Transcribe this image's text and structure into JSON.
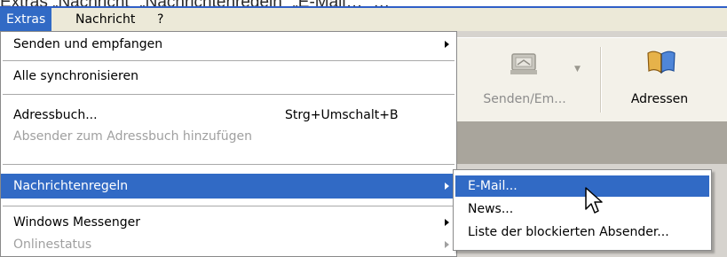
{
  "caption": {
    "text": "Extras „Nachricht“ „Nachrichtenregeln“ „E-Mail…“ …"
  },
  "menubar": {
    "items": [
      {
        "label": "Extras",
        "active": true
      },
      {
        "label": "Nachricht",
        "active": false
      },
      {
        "label": "?",
        "active": false
      }
    ]
  },
  "extras_menu": {
    "items": [
      {
        "label": "Senden und empfangen",
        "shortcut": "",
        "submenu": true,
        "disabled": false,
        "highlighted": false
      },
      {
        "label": "Alle synchronisieren",
        "shortcut": "",
        "submenu": false,
        "disabled": false,
        "highlighted": false
      },
      {
        "label": "Adressbuch...",
        "shortcut": "Strg+Umschalt+B",
        "submenu": false,
        "disabled": false,
        "highlighted": false
      },
      {
        "label": "Absender zum Adressbuch hinzufügen",
        "shortcut": "",
        "submenu": false,
        "disabled": true,
        "highlighted": false
      },
      {
        "label": "Nachrichtenregeln",
        "shortcut": "",
        "submenu": true,
        "disabled": false,
        "highlighted": true
      },
      {
        "label": "Windows Messenger",
        "shortcut": "",
        "submenu": true,
        "disabled": false,
        "highlighted": false
      },
      {
        "label": "Onlinestatus",
        "shortcut": "",
        "submenu": true,
        "disabled": true,
        "highlighted": false
      }
    ]
  },
  "rules_submenu": {
    "items": [
      {
        "label": "E-Mail...",
        "highlighted": true
      },
      {
        "label": "News...",
        "highlighted": false
      },
      {
        "label": "Liste der blockierten Absender...",
        "highlighted": false
      }
    ]
  },
  "toolbar": {
    "send_receive_label": "Senden/Em...",
    "send_receive_disabled": true,
    "addresses_label": "Adressen"
  },
  "icons": {
    "send_receive": "send-receive-icon",
    "addresses": "address-book-icon",
    "cursor": "mouse-pointer-icon"
  },
  "colors": {
    "highlight": "#316ac5",
    "menubar": "#ece9d8"
  }
}
